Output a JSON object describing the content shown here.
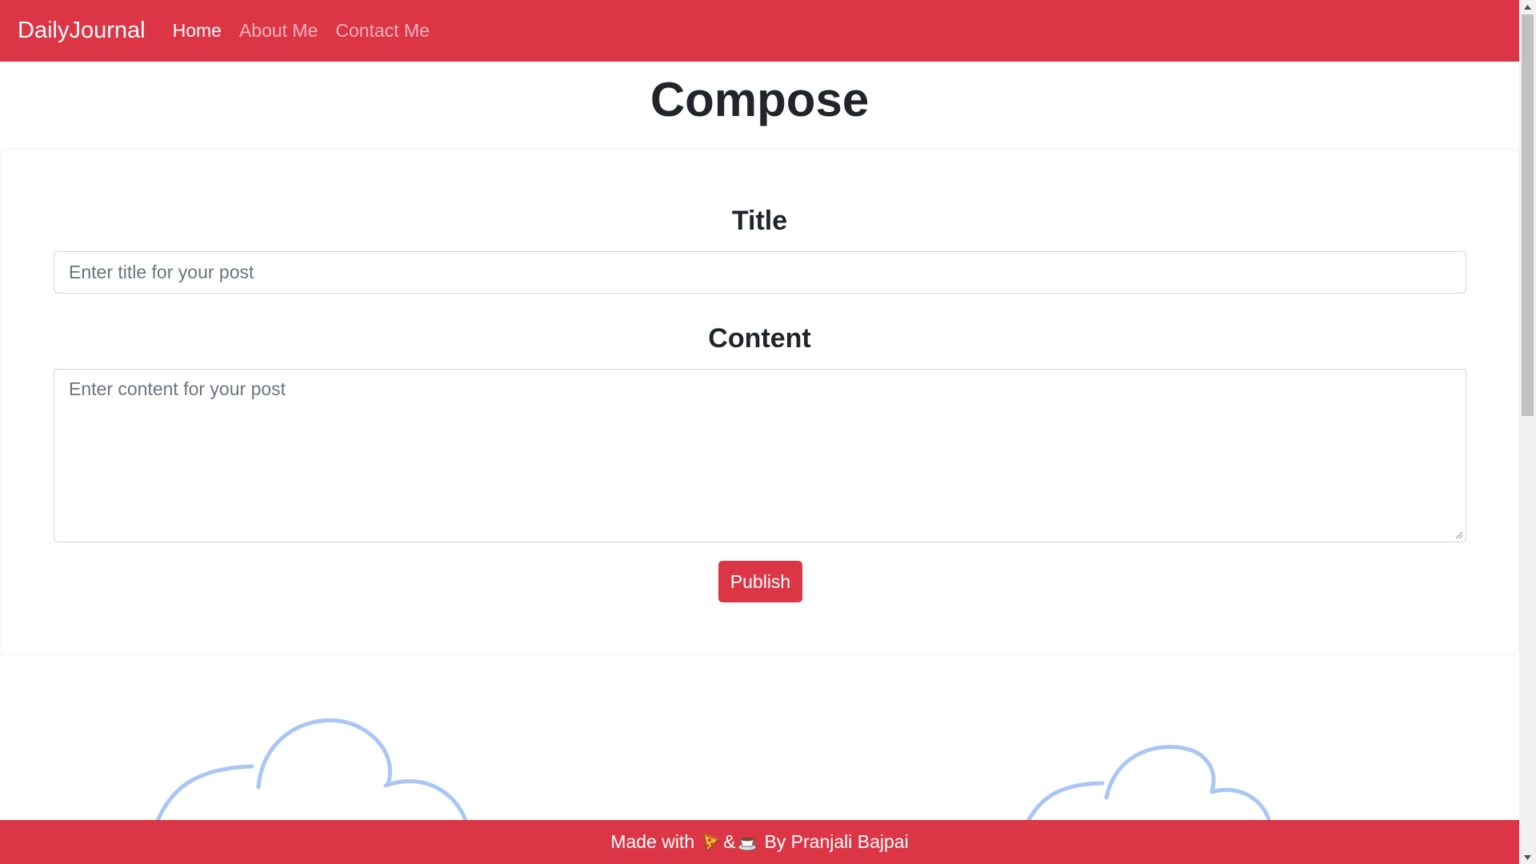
{
  "navbar": {
    "brand": "DailyJournal",
    "links": [
      {
        "label": "Home",
        "active": true
      },
      {
        "label": "About Me",
        "active": false
      },
      {
        "label": "Contact Me",
        "active": false
      }
    ]
  },
  "page": {
    "title": "Compose"
  },
  "form": {
    "title_heading": "Title",
    "title_placeholder": "Enter title for your post",
    "content_heading": "Content",
    "content_placeholder": "Enter content for your post",
    "publish_label": "Publish"
  },
  "footer": {
    "text_before": "Made with",
    "ampersand": "&",
    "text_after": "By Pranjali Bajpai",
    "icons": [
      "pizza-icon",
      "coffee-icon"
    ]
  },
  "colors": {
    "accent": "#dc3545",
    "cloud_stroke": "#a9c6f5"
  }
}
